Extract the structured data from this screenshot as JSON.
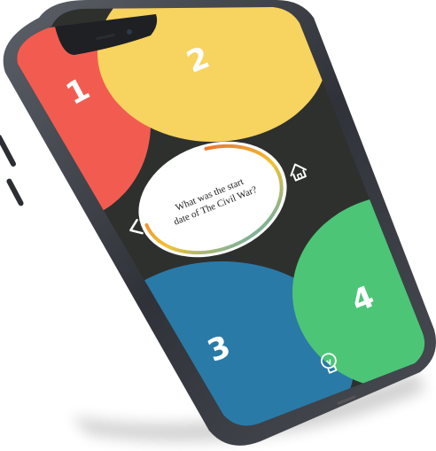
{
  "app": {
    "question": {
      "line1": "What was the start",
      "line2": "date of The Civil War?",
      "timer_progress": 0.72
    },
    "answers": [
      {
        "label": "1",
        "color": "#F25C50"
      },
      {
        "label": "2",
        "color": "#F7D35F"
      },
      {
        "label": "3",
        "color": "#2A7AA8"
      },
      {
        "label": "4",
        "color": "#4CC577"
      }
    ],
    "controls": {
      "home": "home-icon",
      "back": "back-chevron-icon",
      "hint": "lightbulb-icon"
    },
    "colors": {
      "background": "#2E302E",
      "frame": "#3A3D44",
      "timer_start": "#E2442E",
      "timer_mid": "#F2C232",
      "timer_end": "#2FA6DC"
    }
  }
}
